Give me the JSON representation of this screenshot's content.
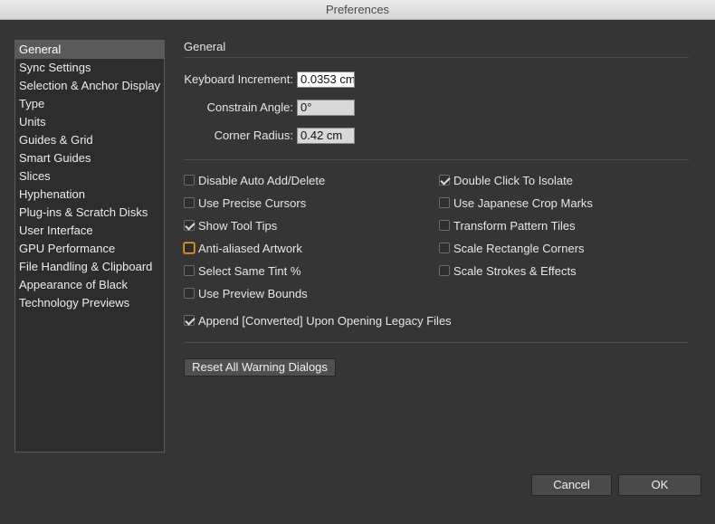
{
  "window": {
    "title": "Preferences"
  },
  "sidebar": {
    "items": [
      {
        "label": "General",
        "selected": true
      },
      {
        "label": "Sync Settings"
      },
      {
        "label": "Selection & Anchor Display"
      },
      {
        "label": "Type"
      },
      {
        "label": "Units"
      },
      {
        "label": "Guides & Grid"
      },
      {
        "label": "Smart Guides"
      },
      {
        "label": "Slices"
      },
      {
        "label": "Hyphenation"
      },
      {
        "label": "Plug-ins & Scratch Disks"
      },
      {
        "label": "User Interface"
      },
      {
        "label": "GPU Performance"
      },
      {
        "label": "File Handling & Clipboard"
      },
      {
        "label": "Appearance of Black"
      },
      {
        "label": "Technology Previews"
      }
    ]
  },
  "general": {
    "title": "General",
    "fields": {
      "keyboard_increment": {
        "label": "Keyboard Increment:",
        "value": "0.0353 cm"
      },
      "constrain_angle": {
        "label": "Constrain Angle:",
        "value": "0°"
      },
      "corner_radius": {
        "label": "Corner Radius:",
        "value": "0.42 cm"
      }
    },
    "options_left": [
      {
        "label": "Disable Auto Add/Delete",
        "checked": false
      },
      {
        "label": "Use Precise Cursors",
        "checked": false
      },
      {
        "label": "Show Tool Tips",
        "checked": true
      },
      {
        "label": "Anti-aliased Artwork",
        "checked": false,
        "focused": true
      },
      {
        "label": "Select Same Tint %",
        "checked": false
      },
      {
        "label": "Use Preview Bounds",
        "checked": false
      }
    ],
    "options_right": [
      {
        "label": "Double Click To Isolate",
        "checked": true
      },
      {
        "label": "Use Japanese Crop Marks",
        "checked": false
      },
      {
        "label": "Transform Pattern Tiles",
        "checked": false
      },
      {
        "label": "Scale Rectangle Corners",
        "checked": false
      },
      {
        "label": "Scale Strokes & Effects",
        "checked": false
      }
    ],
    "append_option": {
      "label": "Append [Converted] Upon Opening Legacy Files",
      "checked": true
    },
    "reset_button": "Reset All Warning Dialogs"
  },
  "footer": {
    "cancel": "Cancel",
    "ok": "OK"
  },
  "colors": {
    "background": "#353535",
    "focus_accent": "#f0a030",
    "selected_item": "#5a5a5a"
  }
}
